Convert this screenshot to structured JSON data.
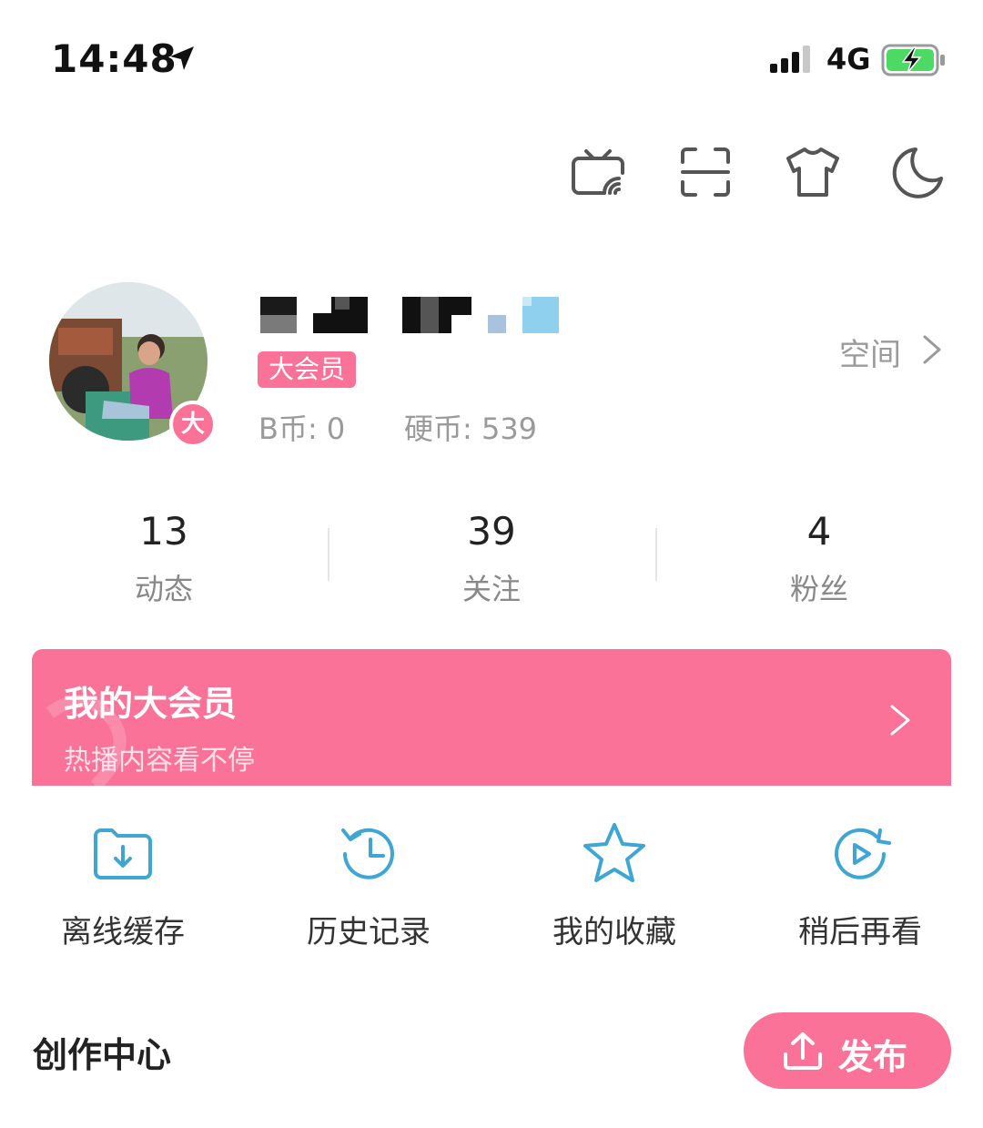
{
  "status_bar": {
    "time": "14:48",
    "network": "4G"
  },
  "header_icons": [
    "tv-cast-icon",
    "scan-icon",
    "tshirt-icon",
    "moon-icon"
  ],
  "profile": {
    "vip_dot": "大",
    "vip_badge": "大会员",
    "bcoin": "B币: 0",
    "coins": "硬币: 539",
    "space_label": "空间"
  },
  "stats": [
    {
      "value": "13",
      "label": "动态"
    },
    {
      "value": "39",
      "label": "关注"
    },
    {
      "value": "4",
      "label": "粉丝"
    }
  ],
  "vip_banner": {
    "title": "我的大会员",
    "subtitle": "热播内容看不停"
  },
  "quick_actions": [
    {
      "label": "离线缓存",
      "icon": "download-folder-icon"
    },
    {
      "label": "历史记录",
      "icon": "history-clock-icon"
    },
    {
      "label": "我的收藏",
      "icon": "star-icon"
    },
    {
      "label": "稍后再看",
      "icon": "watch-later-icon"
    }
  ],
  "creation": {
    "title": "创作中心",
    "publish_label": "发布"
  },
  "colors": {
    "accent": "#fb7299",
    "icon_blue": "#3fa6d4",
    "text_gray": "#9a9a9a"
  }
}
